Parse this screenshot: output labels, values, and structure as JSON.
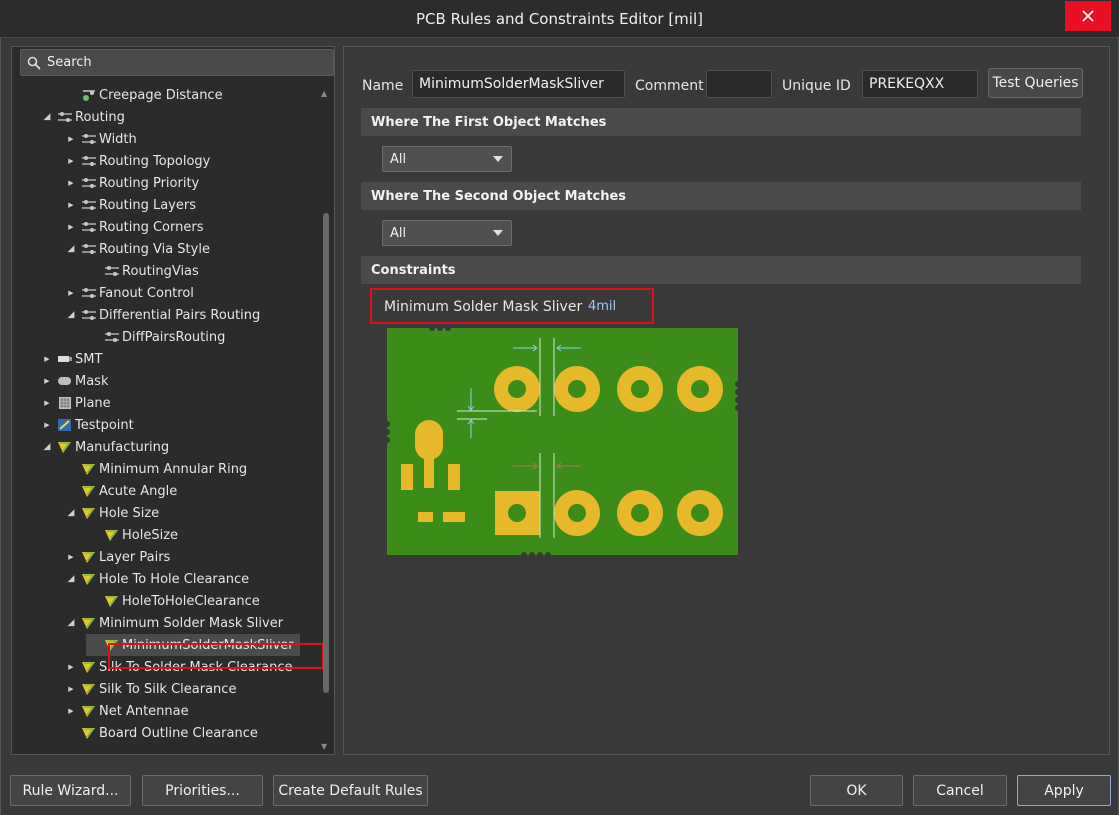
{
  "window": {
    "title": "PCB Rules and Constraints Editor [mil]"
  },
  "search": {
    "label": "Search"
  },
  "tree": [
    {
      "label": "Creepage Distance",
      "level": 2,
      "arrow": "",
      "icon": "creepage"
    },
    {
      "label": "Routing",
      "level": 1,
      "arrow": "expanded",
      "icon": "routing"
    },
    {
      "label": "Width",
      "level": 2,
      "arrow": "collapsed",
      "icon": "routing"
    },
    {
      "label": "Routing Topology",
      "level": 2,
      "arrow": "collapsed",
      "icon": "routing"
    },
    {
      "label": "Routing Priority",
      "level": 2,
      "arrow": "collapsed",
      "icon": "routing"
    },
    {
      "label": "Routing Layers",
      "level": 2,
      "arrow": "collapsed",
      "icon": "routing"
    },
    {
      "label": "Routing Corners",
      "level": 2,
      "arrow": "collapsed",
      "icon": "routing"
    },
    {
      "label": "Routing Via Style",
      "level": 2,
      "arrow": "expanded",
      "icon": "routing"
    },
    {
      "label": "RoutingVias",
      "level": 3,
      "arrow": "",
      "icon": "routing"
    },
    {
      "label": "Fanout Control",
      "level": 2,
      "arrow": "collapsed",
      "icon": "routing"
    },
    {
      "label": "Differential Pairs Routing",
      "level": 2,
      "arrow": "expanded",
      "icon": "routing"
    },
    {
      "label": "DiffPairsRouting",
      "level": 3,
      "arrow": "",
      "icon": "routing"
    },
    {
      "label": "SMT",
      "level": 1,
      "arrow": "collapsed",
      "icon": "smt"
    },
    {
      "label": "Mask",
      "level": 1,
      "arrow": "collapsed",
      "icon": "mask"
    },
    {
      "label": "Plane",
      "level": 1,
      "arrow": "collapsed",
      "icon": "plane"
    },
    {
      "label": "Testpoint",
      "level": 1,
      "arrow": "collapsed",
      "icon": "testpoint"
    },
    {
      "label": "Manufacturing",
      "level": 1,
      "arrow": "expanded",
      "icon": "mfg"
    },
    {
      "label": "Minimum Annular Ring",
      "level": 2,
      "arrow": "",
      "icon": "mfg"
    },
    {
      "label": "Acute Angle",
      "level": 2,
      "arrow": "",
      "icon": "mfg"
    },
    {
      "label": "Hole Size",
      "level": 2,
      "arrow": "expanded",
      "icon": "mfg"
    },
    {
      "label": "HoleSize",
      "level": 3,
      "arrow": "",
      "icon": "mfg"
    },
    {
      "label": "Layer Pairs",
      "level": 2,
      "arrow": "collapsed",
      "icon": "mfg"
    },
    {
      "label": "Hole To Hole Clearance",
      "level": 2,
      "arrow": "expanded",
      "icon": "mfg"
    },
    {
      "label": "HoleToHoleClearance",
      "level": 3,
      "arrow": "",
      "icon": "mfg"
    },
    {
      "label": "Minimum Solder Mask Sliver",
      "level": 2,
      "arrow": "expanded",
      "icon": "mfg"
    },
    {
      "label": "MinimumSolderMaskSliver",
      "level": 3,
      "arrow": "",
      "icon": "mfg",
      "selected": true
    },
    {
      "label": "Silk To Solder Mask Clearance",
      "level": 2,
      "arrow": "collapsed",
      "icon": "mfg"
    },
    {
      "label": "Silk To Silk Clearance",
      "level": 2,
      "arrow": "collapsed",
      "icon": "mfg"
    },
    {
      "label": "Net Antennae",
      "level": 2,
      "arrow": "collapsed",
      "icon": "mfg"
    },
    {
      "label": "Board Outline Clearance",
      "level": 2,
      "arrow": "",
      "icon": "mfg"
    }
  ],
  "rule": {
    "name_label": "Name",
    "name_value": "MinimumSolderMaskSliver",
    "comment_label": "Comment",
    "comment_value": "",
    "uid_label": "Unique ID",
    "uid_value": "PREKEQXX",
    "test_queries": "Test Queries"
  },
  "first_match": {
    "header": "Where The First Object Matches",
    "value": "All"
  },
  "second_match": {
    "header": "Where The Second Object Matches",
    "value": "All"
  },
  "constraints": {
    "header": "Constraints",
    "name": "Minimum Solder Mask Sliver",
    "value": "4mil"
  },
  "buttons": {
    "rule_wizard": "Rule Wizard...",
    "priorities": "Priorities...",
    "create_default": "Create Default Rules",
    "ok": "OK",
    "cancel": "Cancel",
    "apply": "Apply"
  },
  "colors": {
    "board": "#3c8c1a",
    "pad": "#e6b82a",
    "highlight": "#e0101a",
    "arrow_cyan": "#7fd8e0",
    "arrow_brown": "#b07a50"
  }
}
